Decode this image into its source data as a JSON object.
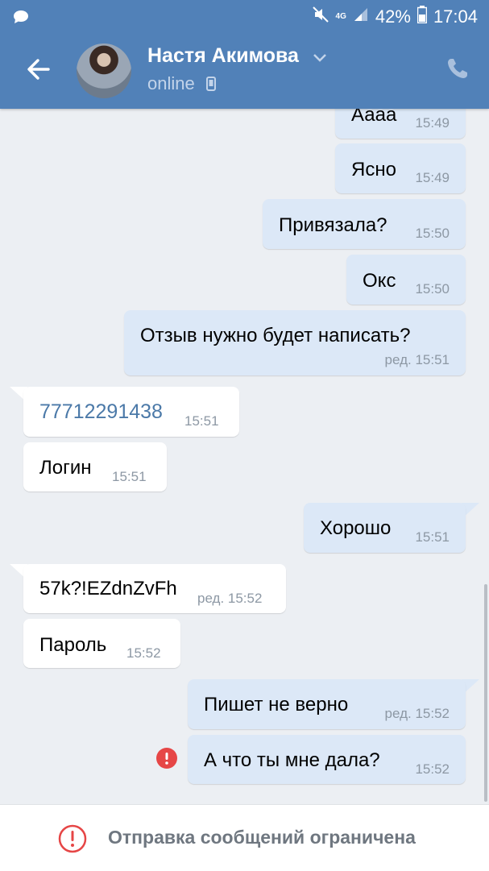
{
  "status_bar": {
    "network": "4G",
    "battery": "42%",
    "time": "17:04"
  },
  "header": {
    "contact_name": "Настя Акимова",
    "presence": "online"
  },
  "messages": [
    {
      "dir": "out",
      "text": "Аааа",
      "time": "15:49"
    },
    {
      "dir": "out",
      "text": "Ясно",
      "time": "15:49"
    },
    {
      "dir": "out",
      "text": "Привязала?",
      "time": "15:50"
    },
    {
      "dir": "out",
      "text": "Окс",
      "time": "15:50"
    },
    {
      "dir": "out",
      "text": "Отзыв нужно будет написать?",
      "time": "ред. 15:51"
    },
    {
      "dir": "in",
      "text": "77712291438",
      "time": "15:51"
    },
    {
      "dir": "in",
      "text": "Логин",
      "time": "15:51"
    },
    {
      "dir": "out",
      "text": "Хорошо",
      "time": "15:51"
    },
    {
      "dir": "in",
      "text": "57k?!EZdnZvFh",
      "time": "ред. 15:52"
    },
    {
      "dir": "in",
      "text": "Пароль",
      "time": "15:52"
    },
    {
      "dir": "out",
      "text": "Пишет не верно",
      "time": "ред. 15:52"
    },
    {
      "dir": "out",
      "text": "А что ты мне дала?",
      "time": "15:52",
      "failed": true
    }
  ],
  "footer": {
    "notice": "Отправка сообщений ограничена"
  },
  "colors": {
    "header_bg": "#5181b8",
    "outgoing_bubble": "#dce8f7",
    "incoming_bubble": "#ffffff",
    "link": "#4b79a8",
    "error": "#e64646"
  },
  "icons": [
    "chat-bubble-icon",
    "mute-icon",
    "signal-icon",
    "battery-icon",
    "back-arrow-icon",
    "chevron-down-icon",
    "mobile-device-icon",
    "phone-icon",
    "error-icon",
    "warning-icon"
  ]
}
